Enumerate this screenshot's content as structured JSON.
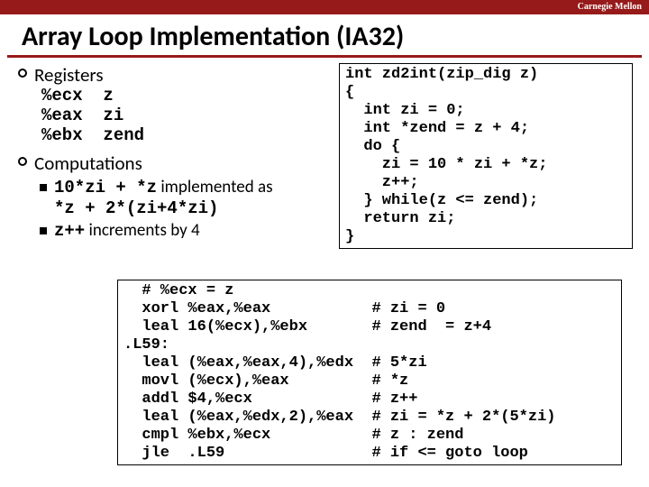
{
  "header": {
    "org": "Carnegie Mellon"
  },
  "title": "Array Loop Implementation (IA32)",
  "sections": {
    "registers": {
      "heading": "Registers",
      "lines": "%ecx  z\n%eax  zi\n%ebx  zend"
    },
    "computations": {
      "heading": "Computations",
      "item1_code_a": "10*zi + *z",
      "item1_text_a": " implemented as",
      "item1_code_b": "*z + 2*(zi+4*zi)",
      "item2_code": "z++",
      "item2_text": " increments by 4"
    }
  },
  "code_c": "int zd2int(zip_dig z)\n{\n  int zi = 0;\n  int *zend = z + 4;\n  do {\n    zi = 10 * zi + *z;\n    z++;\n  } while(z <= zend);\n  return zi;\n}",
  "code_asm": "  # %ecx = z\n  xorl %eax,%eax           # zi = 0\n  leal 16(%ecx),%ebx       # zend  = z+4\n.L59:\n  leal (%eax,%eax,4),%edx  # 5*zi\n  movl (%ecx),%eax         # *z\n  addl $4,%ecx             # z++\n  leal (%eax,%edx,2),%eax  # zi = *z + 2*(5*zi)\n  cmpl %ebx,%ecx           # z : zend\n  jle  .L59                # if <= goto loop"
}
